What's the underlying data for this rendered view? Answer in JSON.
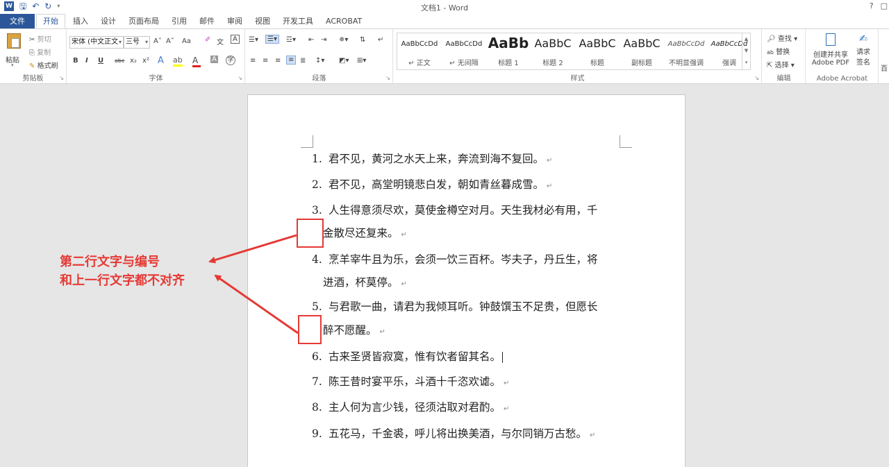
{
  "app": {
    "qat_logo": "W",
    "title": "文档1 - Word",
    "help": "?",
    "restore": "□"
  },
  "tabs": [
    "文件",
    "开始",
    "插入",
    "设计",
    "页面布局",
    "引用",
    "邮件",
    "审阅",
    "视图",
    "开发工具",
    "ACROBAT"
  ],
  "ribbon": {
    "clipboard": {
      "paste": "粘贴",
      "cut": "剪切",
      "copy": "复制",
      "format_painter": "格式刷",
      "label": "剪贴板"
    },
    "font": {
      "font_name": "宋体 (中文正文",
      "font_size": "三号",
      "grow": "A˄",
      "shrink": "A˅",
      "case": "Aa",
      "label": "字体",
      "bold": "B",
      "italic": "I",
      "underline": "U",
      "strike": "abc",
      "sub": "x₂",
      "sup": "x²"
    },
    "paragraph": {
      "label": "段落"
    },
    "styles": {
      "label": "样式",
      "items": [
        {
          "sample": "AaBbCcDd",
          "name": "↵ 正文"
        },
        {
          "sample": "AaBbCcDd",
          "name": "↵ 无间隔"
        },
        {
          "sample": "AaBb",
          "name": "标题 1"
        },
        {
          "sample": "AaBbC",
          "name": "标题 2"
        },
        {
          "sample": "AaBbC",
          "name": "标题"
        },
        {
          "sample": "AaBbC",
          "name": "副标题"
        },
        {
          "sample": "AaBbCcDd",
          "name": "不明显强调"
        },
        {
          "sample": "AaBbCcDd",
          "name": "强调"
        }
      ]
    },
    "editing": {
      "find": "查找",
      "replace": "替换",
      "select": "选择",
      "label": "编辑"
    },
    "acrobat": {
      "create_share": "创建并共享",
      "adobe_pdf": "Adobe PDF",
      "request": "请求",
      "sign": "签名",
      "label": "Adobe Acrobat",
      "extra": "百"
    }
  },
  "document": {
    "lines": [
      {
        "num": "1.",
        "text": "君不见，黄河之水天上来，奔流到海不复回。"
      },
      {
        "num": "2.",
        "text": "君不见，高堂明镜悲白发，朝如青丝暮成雪。"
      },
      {
        "num": "3.",
        "text": "人生得意须尽欢，莫使金樽空对月。天生我材必有用，千"
      },
      {
        "num": "",
        "text": "金散尽还复来。"
      },
      {
        "num": "4.",
        "text": "烹羊宰牛且为乐，会须一饮三百杯。岑夫子，丹丘生，将"
      },
      {
        "num": "",
        "text": "进酒，杯莫停。"
      },
      {
        "num": "5.",
        "text": "与君歌一曲，请君为我倾耳听。钟鼓馔玉不足贵，但愿长"
      },
      {
        "num": "",
        "text": "醉不愿醒。"
      },
      {
        "num": "6.",
        "text": "古来圣贤皆寂寞，惟有饮者留其名。"
      },
      {
        "num": "7.",
        "text": "陈王昔时宴平乐，斗酒十千恣欢谑。"
      },
      {
        "num": "8.",
        "text": "主人何为言少钱，径须沽取对君酌。"
      },
      {
        "num": "9.",
        "text": "五花马，千金裘，呼儿将出换美酒，与尔同销万古愁。"
      }
    ],
    "para_mark": "↵"
  },
  "annotation": {
    "line1": "第二行文字与编号",
    "line2": "和上一行文字都不对齐",
    "color": "#e53935"
  }
}
